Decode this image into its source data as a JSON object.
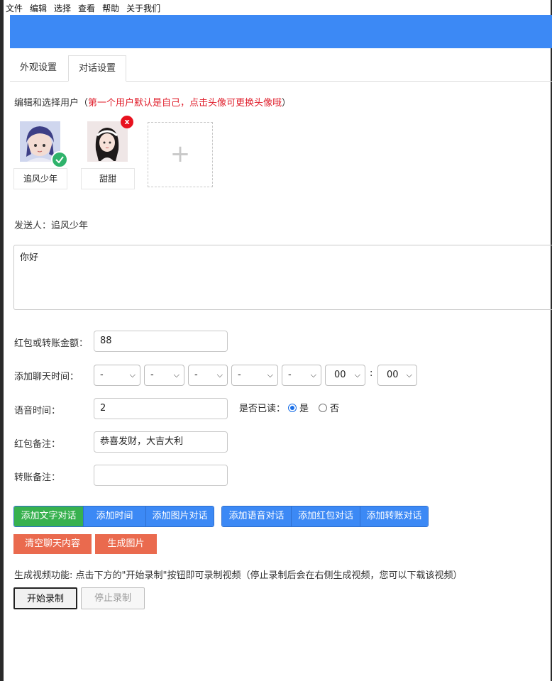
{
  "menu": [
    "文件",
    "编辑",
    "选择",
    "查看",
    "帮助",
    "关于我们"
  ],
  "colors": {
    "accent": "#3c89f5",
    "green": "#37b14f",
    "orange": "#ea6a4e",
    "hint_red": "#e0202d"
  },
  "tabs": [
    {
      "label": "外观设置",
      "active": false
    },
    {
      "label": "对话设置",
      "active": true
    }
  ],
  "hint": {
    "prefix": "编辑和选择用户（",
    "red": "第一个用户默认是自己，点击头像可更换头像哦",
    "suffix": "）"
  },
  "users": [
    {
      "name": "追风少年",
      "selected": true
    },
    {
      "name": "甜甜",
      "selected": false,
      "delete_label": "x"
    }
  ],
  "add_user_symbol": "+",
  "sender": {
    "label": "发送人：",
    "name": "追风少年"
  },
  "message_text": "你好",
  "fields": {
    "amount": {
      "label": "红包或转账金额：",
      "value": "88"
    },
    "time": {
      "label": "添加聊天时间：",
      "selects": [
        "-",
        "-",
        "-",
        "-",
        "-",
        "00",
        "00"
      ],
      "separator": ":"
    },
    "voice": {
      "label": "语音时间：",
      "value": "2",
      "read_label": "是否已读：",
      "yes": "是",
      "no": "否",
      "read": true
    },
    "redpacket_note": {
      "label": "红包备注：",
      "value": "恭喜发财，大吉大利"
    },
    "transfer_note": {
      "label": "转账备注：",
      "value": ""
    }
  },
  "buttons": {
    "add_text": "添加文字对话",
    "add_time": "添加时间",
    "add_image": "添加图片对话",
    "add_voice": "添加语音对话",
    "add_redpacket": "添加红包对话",
    "add_transfer": "添加转账对话",
    "clear": "清空聊天内容",
    "generate": "生成图片"
  },
  "video": {
    "hint": "生成视频功能: 点击下方的\"开始录制\"按钮即可录制视频（停止录制后会在右侧生成视频，您可以下载该视频）",
    "start": "开始录制",
    "stop": "停止录制"
  }
}
